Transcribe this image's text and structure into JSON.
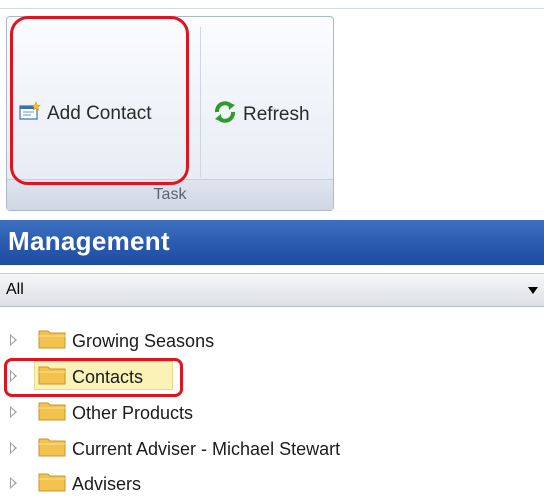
{
  "ribbon": {
    "group_label": "Task",
    "buttons": [
      {
        "label": "Add Contact",
        "icon": "add-contact-icon"
      },
      {
        "label": "Refresh",
        "icon": "refresh-icon"
      }
    ]
  },
  "panel": {
    "title": "Management",
    "filter": {
      "selected": "All"
    }
  },
  "tree": {
    "items": [
      {
        "label": "Growing Seasons",
        "icon": "folder-icon"
      },
      {
        "label": "Contacts",
        "icon": "folder-icon",
        "selected": true
      },
      {
        "label": "Other Products",
        "icon": "folder-icon"
      },
      {
        "label": "Current Adviser - Michael Stewart",
        "icon": "folder-icon"
      },
      {
        "label": "Advisers",
        "icon": "folder-icon"
      }
    ]
  },
  "colors": {
    "header_blue": "#2a5bb0",
    "highlight_red": "#e0141f",
    "selection_yellow": "#fbf2b8",
    "folder_yellow": "#f2c14e"
  }
}
